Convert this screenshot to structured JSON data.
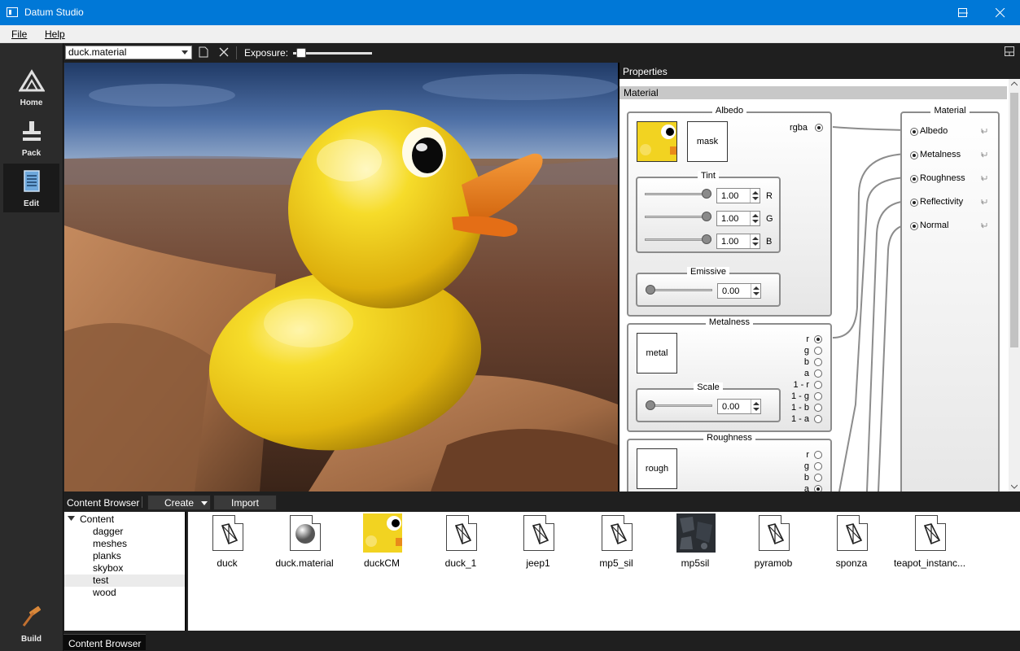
{
  "window": {
    "title": "Datum Studio"
  },
  "menu": {
    "file": "File",
    "help": "Help"
  },
  "rail": {
    "home": "Home",
    "pack": "Pack",
    "edit": "Edit",
    "build": "Build"
  },
  "toolbar": {
    "file_selected": "duck.material",
    "exposure_label": "Exposure:",
    "exposure_value_fraction": 0.05
  },
  "properties": {
    "header": "Properties",
    "section": "Material",
    "albedo": {
      "title": "Albedo",
      "mask_label": "mask",
      "output_label": "rgba",
      "tint": {
        "title": "Tint",
        "channels": [
          {
            "label": "R",
            "value": "1.00"
          },
          {
            "label": "G",
            "value": "1.00"
          },
          {
            "label": "B",
            "value": "1.00"
          }
        ]
      },
      "emissive": {
        "title": "Emissive",
        "value": "0.00"
      }
    },
    "metalness": {
      "title": "Metalness",
      "map_label": "metal",
      "scale": {
        "title": "Scale",
        "value": "0.00"
      },
      "channels": [
        "r",
        "g",
        "b",
        "a",
        "1 - r",
        "1 - g",
        "1 - b",
        "1 - a"
      ],
      "selected": "r"
    },
    "roughness": {
      "title": "Roughness",
      "map_label": "rough",
      "channels": [
        "r",
        "g",
        "b",
        "a"
      ],
      "selected": "a"
    },
    "material_node": {
      "title": "Material",
      "inputs": [
        "Albedo",
        "Metalness",
        "Roughness",
        "Reflectivity",
        "Normal"
      ]
    }
  },
  "content_browser": {
    "title": "Content Browser",
    "create_label": "Create",
    "import_label": "Import",
    "tree": {
      "root": "Content",
      "children": [
        "dagger",
        "meshes",
        "planks",
        "skybox",
        "test",
        "wood"
      ],
      "selected": "test"
    },
    "assets": [
      "duck",
      "duck.material",
      "duckCM",
      "duck_1",
      "jeep1",
      "mp5_sil",
      "mp5sil",
      "pyramob",
      "sponza",
      "teapot_instanc..."
    ],
    "bottom_tab": "Content Browser"
  },
  "colors": {
    "accent": "#0078d7",
    "duck_yellow": "#f2d321",
    "beak_orange": "#f07d1a"
  }
}
